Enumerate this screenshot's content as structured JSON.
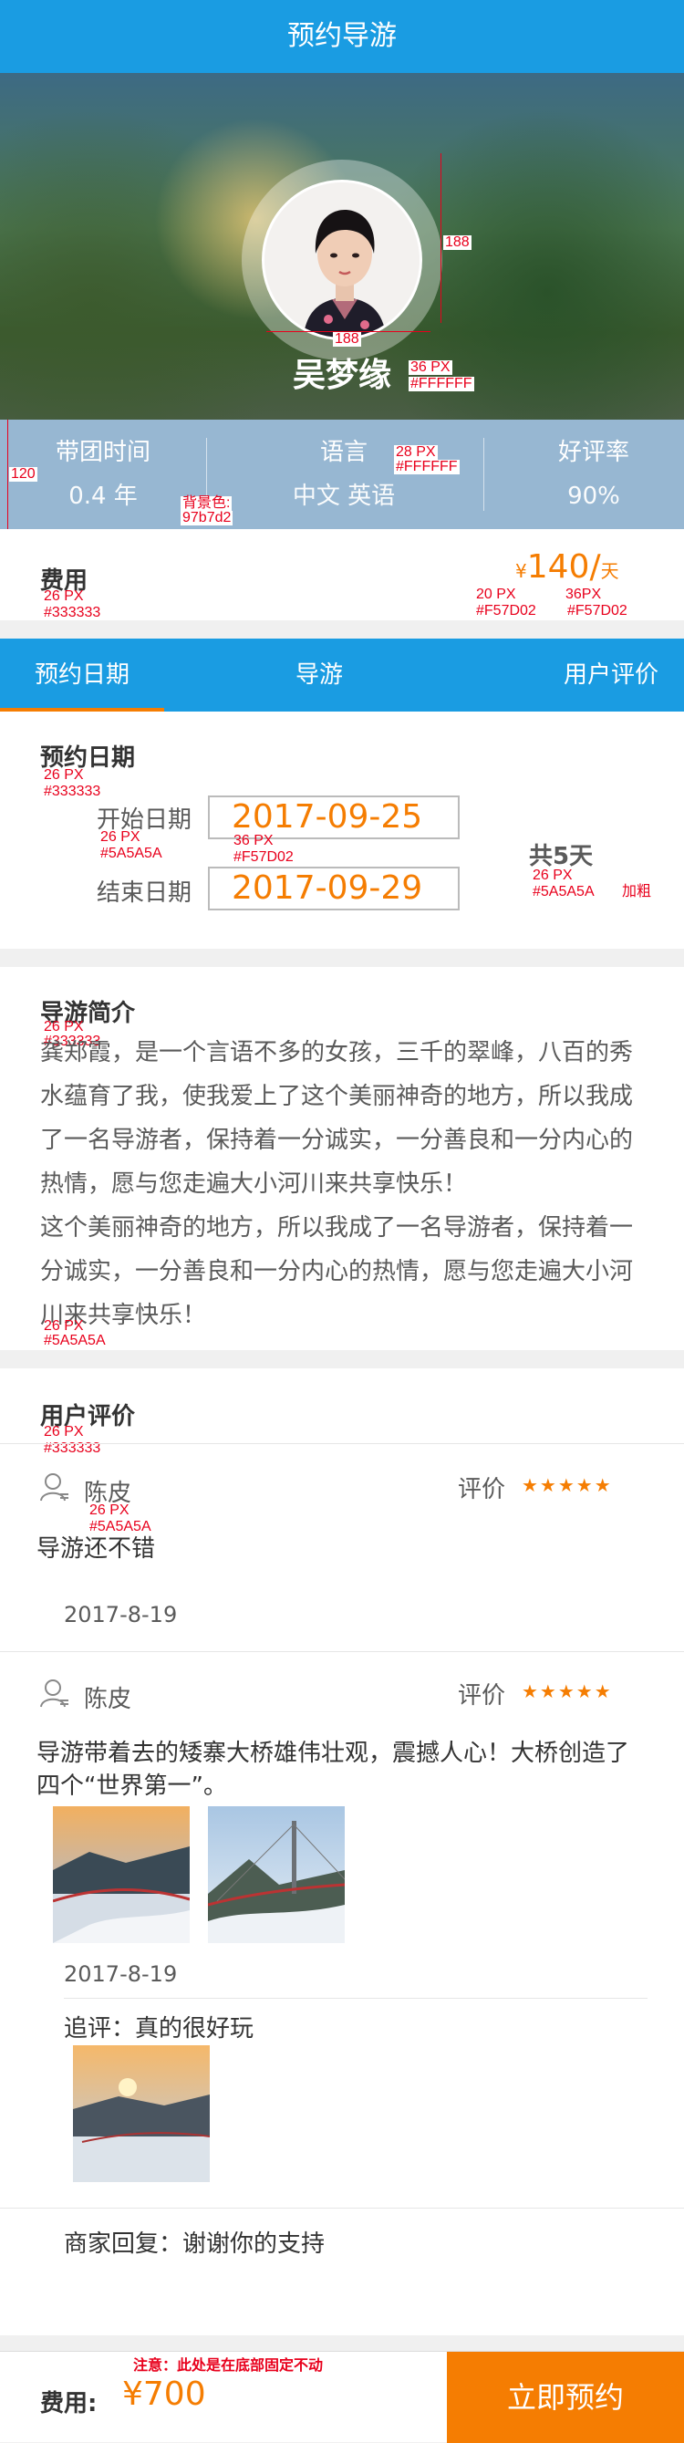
{
  "header": {
    "title": "预约导游"
  },
  "guide": {
    "name": "吴梦缘"
  },
  "stats": [
    {
      "label": "带团时间",
      "value": "0.4 年"
    },
    {
      "label": "语言",
      "value": "中文 英语"
    },
    {
      "label": "好评率",
      "value": "90%"
    }
  ],
  "fee": {
    "label": "费用",
    "currency": "¥",
    "amount": "140/",
    "unit": "天"
  },
  "tabs": [
    "预约日期",
    "导游",
    "用户评价"
  ],
  "booking": {
    "title": "预约日期",
    "start_label": "开始日期",
    "start_date": "2017-09-25",
    "end_label": "结束日期",
    "end_date": "2017-09-29",
    "days_text": "共5天"
  },
  "intro": {
    "title": "导游简介",
    "paragraphs": [
      "龚郑霞，是一个言语不多的女孩，三千的翠峰，八百的秀水蕴育了我，使我爱上了这个美丽神奇的地方，所以我成了一名导游者，保持着一分诚实，一分善良和一分内心的热情，愿与您走遍大小河川来共享快乐！",
      "这个美丽神奇的地方，所以我成了一名导游者，保持着一分诚实，一分善良和一分内心的热情，愿与您走遍大小河川来共享快乐！"
    ]
  },
  "reviews": {
    "title": "用户评价",
    "items": [
      {
        "user": "陈皮",
        "rate_label": "评价",
        "stars": "★★★★★",
        "text": "导游还不错",
        "date": "2017-8-19"
      },
      {
        "user": "陈皮",
        "rate_label": "评价",
        "stars": "★★★★★",
        "text": "导游带着去的矮寨大桥雄伟壮观，震撼人心！大桥创造了四个“世界第一”。",
        "date": "2017-8-19",
        "followup": "追评：真的很好玩",
        "merchant_reply": "商家回复：谢谢你的支持"
      }
    ]
  },
  "bottom": {
    "fee_label": "费用:",
    "total": "¥700",
    "book_button": "立即预约"
  },
  "annotations": {
    "a188_v": "188",
    "a188_h": "188",
    "name_size": "36 PX",
    "name_color": "#FFFFFF",
    "lang_size": "28 PX",
    "lang_color": "#FFFFFF",
    "bg_label": "背景色:",
    "bg_color": "97b7d2",
    "h120": "120",
    "w750": "750",
    "fee_size": "26 PX",
    "fee_color": "#333333",
    "price_size_a": "20 PX",
    "price_color_a": "#F57D02",
    "price_size_b": "36PX",
    "price_color_b": "#F57D02",
    "booking_title_size": "26 PX",
    "booking_title_color": "#333333",
    "date_label_size": "26 PX",
    "date_label_color": "#5A5A5A",
    "date_size": "36 PX",
    "date_color": "#F57D02",
    "days_size": "26 PX",
    "days_color": "#5A5A5A",
    "days_bold": "加粗",
    "intro_title_size": "26 PX",
    "intro_title_color": "#333333",
    "intro_text_size": "26 PX",
    "intro_text_color": "#5A5A5A",
    "reviews_title_size": "26 PX",
    "reviews_title_color": "#333333",
    "user_size": "26 PX",
    "user_color": "#5A5A5A",
    "fixed_note": "注意：此处是在底部固定不动"
  },
  "colors": {
    "primary": "#1a9ce2",
    "accent": "#f57d02",
    "stats_bg": "#97b7d2"
  }
}
